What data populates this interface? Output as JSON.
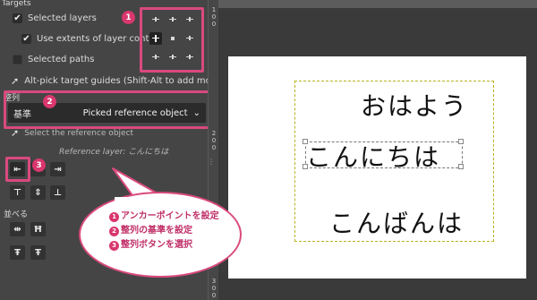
{
  "panel": {
    "targets_title": "Targets",
    "selected_layers": "Selected layers",
    "use_extents": "Use extents of layer contents",
    "selected_paths": "Selected paths",
    "alt_pick_hint": "Alt-pick target guides (Shift-Alt to add more)",
    "align_title": "整列",
    "reference_label": "基準",
    "reference_value": "Picked reference object",
    "select_reference_hint": "Select the reference object",
    "reference_layer": "Reference layer: こんにちは",
    "distribute_title": "並べる"
  },
  "badges": {
    "one": "1",
    "two": "2",
    "three": "3"
  },
  "canvas": {
    "line1": "おはよう",
    "line2": "こんにちは",
    "line3": "こんばんは"
  },
  "callout": {
    "step1": "アンカーポイントを設定",
    "step2": "整列の基準を設定",
    "step3": "整列ボタンを選択"
  },
  "ruler": {
    "ticks": [
      "1",
      "0",
      "0",
      "2",
      "0",
      "0",
      "3",
      "0",
      "0"
    ]
  },
  "colors": {
    "accent": "#d94a7e",
    "panel_bg": "#454545",
    "canvas_bg": "#ffffff"
  },
  "icons": {
    "checkmark": "check-icon",
    "pointer": "pointer-icon",
    "chevron": "chevron-down-icon"
  }
}
